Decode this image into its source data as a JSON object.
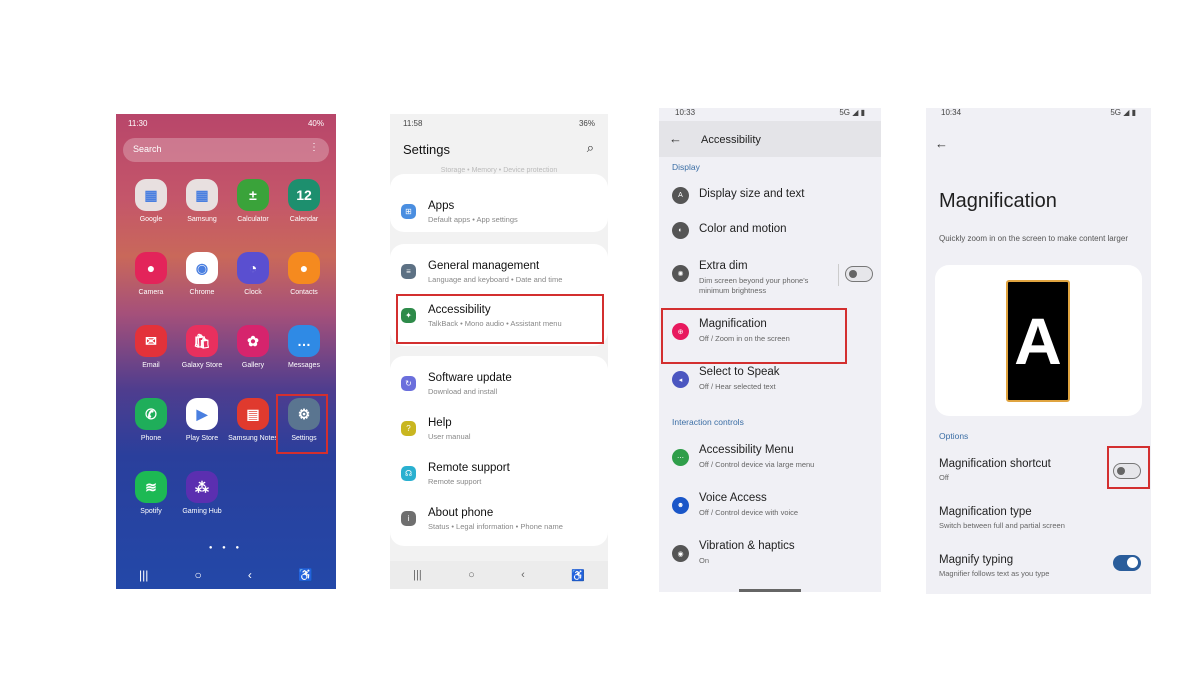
{
  "colors": {
    "highlight": "#d32f2f",
    "section_header": "#3b6ea5",
    "toggle_on": "#2a5d9b"
  },
  "phone1": {
    "status": {
      "time": "11:30",
      "right": "40%"
    },
    "search_placeholder": "Search",
    "apps": [
      {
        "label": "Google",
        "icon": "google-folder-icon",
        "glyph": "▦",
        "color": "#e8e0e0"
      },
      {
        "label": "Samsung",
        "icon": "samsung-folder-icon",
        "glyph": "▦",
        "color": "#e8e0e0"
      },
      {
        "label": "Calculator",
        "icon": "calculator-icon",
        "glyph": "±",
        "color": "#3aa33a"
      },
      {
        "label": "Calendar",
        "icon": "calendar-icon",
        "glyph": "12",
        "color": "#1d8f6e"
      },
      {
        "label": "Camera",
        "icon": "camera-icon",
        "glyph": "●",
        "color": "#e3245a"
      },
      {
        "label": "Chrome",
        "icon": "chrome-icon",
        "glyph": "◉",
        "color": "#ffffff"
      },
      {
        "label": "Clock",
        "icon": "clock-icon",
        "glyph": "◔",
        "color": "#5a4fd0"
      },
      {
        "label": "Contacts",
        "icon": "contacts-icon",
        "glyph": "●",
        "color": "#f58a1f"
      },
      {
        "label": "Email",
        "icon": "email-icon",
        "glyph": "✉",
        "color": "#e3323a"
      },
      {
        "label": "Galaxy Store",
        "icon": "galaxy-store-icon",
        "glyph": "🛍",
        "color": "#e8305e"
      },
      {
        "label": "Gallery",
        "icon": "gallery-icon",
        "glyph": "✿",
        "color": "#d6246d"
      },
      {
        "label": "Messages",
        "icon": "messages-icon",
        "glyph": "…",
        "color": "#2f8ae5"
      },
      {
        "label": "Phone",
        "icon": "phone-icon",
        "glyph": "✆",
        "color": "#1fae5a"
      },
      {
        "label": "Play Store",
        "icon": "play-store-icon",
        "glyph": "▶",
        "color": "#ffffff"
      },
      {
        "label": "Samsung Notes",
        "icon": "samsung-notes-icon",
        "glyph": "▤",
        "color": "#e03a2e"
      },
      {
        "label": "Settings",
        "icon": "settings-icon",
        "glyph": "⚙",
        "color": "#5a7590"
      },
      {
        "label": "Spotify",
        "icon": "spotify-icon",
        "glyph": "≋",
        "color": "#1db954"
      },
      {
        "label": "Gaming Hub",
        "icon": "gaming-hub-icon",
        "glyph": "⁂",
        "color": "#5b2fb0"
      }
    ],
    "pager": "● ● ●",
    "nav": {
      "recents": "|||",
      "home": "○",
      "back": "‹",
      "accessibility": "♿"
    }
  },
  "phone2": {
    "status": {
      "time": "11:58",
      "right": "36%"
    },
    "title": "Settings",
    "faded_text": "Storage • Memory • Device protection",
    "items": [
      {
        "title": "Apps",
        "subtitle": "Default apps • App settings",
        "icon": "apps-icon",
        "glyph": "⊞",
        "color": "#4a8ee0"
      },
      {
        "title": "General management",
        "subtitle": "Language and keyboard • Date and time",
        "icon": "general-management-icon",
        "glyph": "≡",
        "color": "#5d7184"
      },
      {
        "title": "Accessibility",
        "subtitle": "TalkBack • Mono audio • Assistant menu",
        "icon": "accessibility-icon",
        "glyph": "✦",
        "color": "#2e8b4a"
      },
      {
        "title": "Software update",
        "subtitle": "Download and install",
        "icon": "software-update-icon",
        "glyph": "↻",
        "color": "#6b6fdc"
      },
      {
        "title": "Help",
        "subtitle": "User manual",
        "icon": "help-icon",
        "glyph": "?",
        "color": "#c9b620"
      },
      {
        "title": "Remote support",
        "subtitle": "Remote support",
        "icon": "remote-support-icon",
        "glyph": "☊",
        "color": "#2ab0d0"
      },
      {
        "title": "About phone",
        "subtitle": "Status • Legal information • Phone name",
        "icon": "about-phone-icon",
        "glyph": "i",
        "color": "#6f6f6f"
      }
    ],
    "nav": {
      "recents": "|||",
      "home": "○",
      "back": "‹",
      "accessibility": "♿"
    }
  },
  "phone3": {
    "status": {
      "time": "10:33",
      "right": "5G ◢ ▮"
    },
    "title": "Accessibility",
    "sections": {
      "display": "Display",
      "interaction": "Interaction controls"
    },
    "display_items": [
      {
        "title": "Display size and text",
        "subtitle": "",
        "icon": "display-size-icon",
        "glyph": "A",
        "color": "#555555"
      },
      {
        "title": "Color and motion",
        "subtitle": "",
        "icon": "color-motion-icon",
        "glyph": "◐",
        "color": "#555555"
      },
      {
        "title": "Extra dim",
        "subtitle": "Dim screen beyond your phone's minimum brightness",
        "icon": "extra-dim-icon",
        "glyph": "✺",
        "color": "#555555",
        "toggle": false
      },
      {
        "title": "Magnification",
        "subtitle": "Off / Zoom in on the screen",
        "icon": "magnification-icon",
        "glyph": "⊕",
        "color": "#e8195e"
      },
      {
        "title": "Select to Speak",
        "subtitle": "Off / Hear selected text",
        "icon": "select-to-speak-icon",
        "glyph": "◂",
        "color": "#4b56c0"
      }
    ],
    "interaction_items": [
      {
        "title": "Accessibility Menu",
        "subtitle": "Off / Control device via large menu",
        "icon": "accessibility-menu-icon",
        "glyph": "⋯",
        "color": "#2f9e4a"
      },
      {
        "title": "Voice Access",
        "subtitle": "Off / Control device with voice",
        "icon": "voice-access-icon",
        "glyph": "☻",
        "color": "#1a56c8"
      },
      {
        "title": "Vibration & haptics",
        "subtitle": "On",
        "icon": "vibration-icon",
        "glyph": "◉",
        "color": "#555555"
      }
    ]
  },
  "phone4": {
    "status": {
      "time": "10:34",
      "right": "5G ◢ ▮"
    },
    "title": "Magnification",
    "description": "Quickly zoom in on the screen to make content larger",
    "illustration_letter": "A",
    "options_header": "Options",
    "options": [
      {
        "title": "Magnification shortcut",
        "subtitle": "Off",
        "toggle": false
      },
      {
        "title": "Magnification type",
        "subtitle": "Switch between full and partial screen"
      },
      {
        "title": "Magnify typing",
        "subtitle": "Magnifier follows text as you type",
        "toggle": true
      }
    ]
  }
}
